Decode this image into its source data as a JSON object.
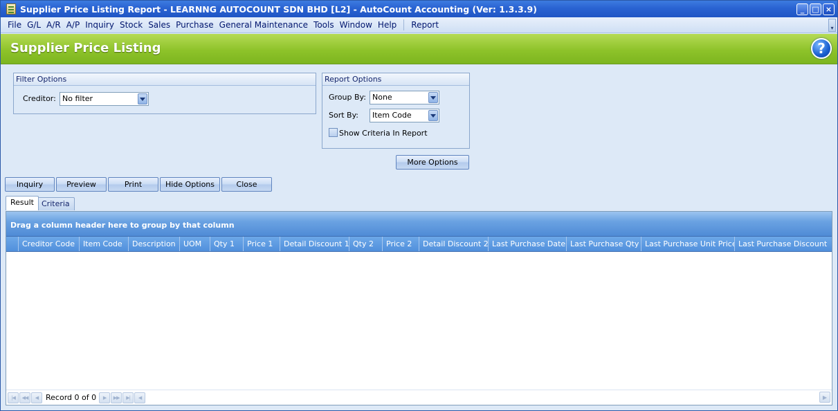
{
  "window": {
    "title": "Supplier Price Listing Report - LEARNNG AUTOCOUNT SDN BHD [L2] - AutoCount Accounting (Ver: 1.3.3.9)",
    "minimize_glyph": "_",
    "maximize_glyph": "□",
    "close_glyph": "×"
  },
  "menu": {
    "items": [
      "File",
      "G/L",
      "A/R",
      "A/P",
      "Inquiry",
      "Stock",
      "Sales",
      "Purchase",
      "General Maintenance",
      "Tools",
      "Window",
      "Help"
    ],
    "report": "Report",
    "scroll_glyph": "▾"
  },
  "header": {
    "title": "Supplier Price Listing",
    "help_glyph": "?"
  },
  "filter_options": {
    "title": "Filter Options",
    "creditor_label": "Creditor:",
    "creditor_value": "No filter"
  },
  "report_options": {
    "title": "Report Options",
    "group_by_label": "Group By:",
    "group_by_value": "None",
    "sort_by_label": "Sort By:",
    "sort_by_value": "Item Code",
    "show_criteria_label": "Show Criteria In Report",
    "show_criteria_checked": false
  },
  "buttons": {
    "more_options": "More Options",
    "inquiry": "Inquiry",
    "preview": "Preview",
    "print": "Print",
    "hide_options": "Hide Options",
    "close": "Close"
  },
  "tabs": {
    "result": "Result",
    "criteria": "Criteria",
    "active": "result"
  },
  "grid": {
    "group_hint": "Drag a column header here to group by that column",
    "columns": [
      "Creditor Code",
      "Item Code",
      "Description",
      "UOM",
      "Qty 1",
      "Price 1",
      "Detail Discount 1",
      "Qty 2",
      "Price 2",
      "Detail Discount 2",
      "Last Purchase Date",
      "Last Purchase Qty",
      "Last Purchase Unit Price",
      "Last Purchase Discount"
    ],
    "rows": [],
    "record_text": "Record 0 of 0"
  },
  "icons": {
    "nav_first": "first-record-icon",
    "nav_prev_page": "previous-page-icon",
    "nav_prev": "previous-record-icon",
    "nav_next": "next-record-icon",
    "nav_next_page": "next-page-icon",
    "nav_last": "last-record-icon"
  }
}
